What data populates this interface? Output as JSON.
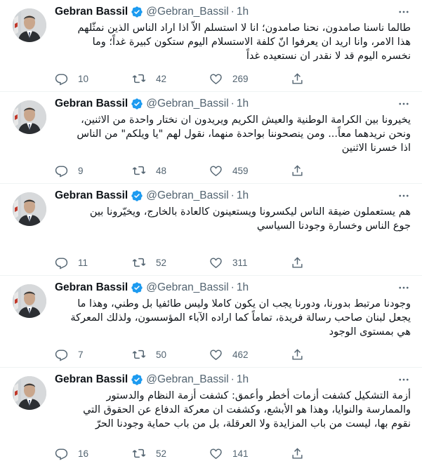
{
  "author": {
    "name": "Gebran Bassil",
    "handle": "@Gebran_Bassil",
    "time": "1h",
    "verified": true
  },
  "colors": {
    "text": "#0f1419",
    "secondary": "#536471",
    "verified": "#1d9bf0",
    "divider": "#eff3f4"
  },
  "tweets": [
    {
      "lines": [
        "طالما ناسنا صامدون، نحنا صامدون؛ انا لا استسلم الاّ اذا اراد الناس الذين نمثّلهم",
        "هذا الامر، وانا اريد ان يعرفوا انّ كلفة الاستسلام اليوم ستكون كبيرة غداً؛ وما",
        "نخسره اليوم قد لا نقدر ان نستعيده غداً"
      ],
      "replies": "10",
      "retweets": "42",
      "likes": "269"
    },
    {
      "lines": [
        "يخيرونا بين الكرامة الوطنية والعيش الكريم ويريدون ان نختار واحدة من الاثنين،",
        "ونحن نريدهما معاً... ومن ينصحوننا بواحدة منهما، نقول لهم \"يا ويلكم\" من الناس",
        "اذا خسرنا الاثنين"
      ],
      "replies": "9",
      "retweets": "48",
      "likes": "459"
    },
    {
      "lines": [
        "هم يستعملون ضيقة الناس ليكسرونا ويستعينون كالعادة بالخارج، ويخيّرونا بين",
        "جوع الناس وخسارة وجودنا السياسي"
      ],
      "replies": "11",
      "retweets": "52",
      "likes": "311"
    },
    {
      "lines": [
        "وجودنا مرتبط بدورنا، ودورنا يجب ان يكون كاملا وليس طائفيا بل وطني، وهذا ما",
        "يجعل لبنان صاحب رسالة فريدة، تماماً كما اراده الآباء المؤسسون، ولذلك المعركة",
        "هي بمستوى الوجود"
      ],
      "replies": "7",
      "retweets": "50",
      "likes": "462"
    },
    {
      "lines": [
        "أزمة التشكيل كشفت أزمات أخطر وأعمق: كشفت أزمة النظام والدستور",
        "والممارسة والنوايا، وهذا هو الأبشع، وكشفت ان معركة الدفاع عن الحقوق التي",
        "نقوم بها، ليست من باب المزايدة ولا العرقلة، بل من باب حماية وجودنا الحرّ"
      ],
      "replies": "16",
      "retweets": "52",
      "likes": "141"
    }
  ]
}
